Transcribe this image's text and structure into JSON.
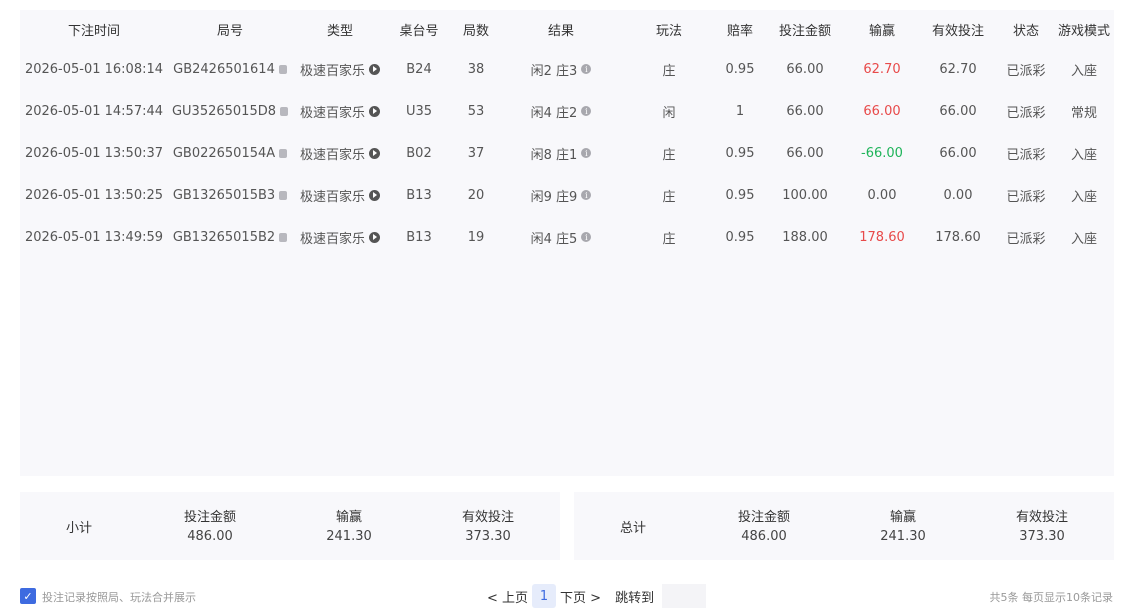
{
  "table": {
    "headers": [
      "下注时间",
      "局号",
      "类型",
      "桌台号",
      "局数",
      "结果",
      "玩法",
      "赔率",
      "投注金额",
      "输赢",
      "有效投注",
      "状态",
      "游戏模式"
    ],
    "rows": [
      {
        "time": "2026-05-01 16:08:14",
        "round_id": "GB2426501614",
        "type": "极速百家乐",
        "table": "B24",
        "count": "38",
        "result": "闲2 庄3",
        "play": "庄",
        "odds": "0.95",
        "bet": "66.00",
        "winloss": "62.70",
        "winloss_color": "red",
        "valid": "62.70",
        "status": "已派彩",
        "mode": "入座"
      },
      {
        "time": "2026-05-01 14:57:44",
        "round_id": "GU35265015D8",
        "type": "极速百家乐",
        "table": "U35",
        "count": "53",
        "result": "闲4 庄2",
        "play": "闲",
        "odds": "1",
        "bet": "66.00",
        "winloss": "66.00",
        "winloss_color": "red",
        "valid": "66.00",
        "status": "已派彩",
        "mode": "常规"
      },
      {
        "time": "2026-05-01 13:50:37",
        "round_id": "GB022650154A",
        "type": "极速百家乐",
        "table": "B02",
        "count": "37",
        "result": "闲8 庄1",
        "play": "庄",
        "odds": "0.95",
        "bet": "66.00",
        "winloss": "-66.00",
        "winloss_color": "green",
        "valid": "66.00",
        "status": "已派彩",
        "mode": "入座"
      },
      {
        "time": "2026-05-01 13:50:25",
        "round_id": "GB13265015B3",
        "type": "极速百家乐",
        "table": "B13",
        "count": "20",
        "result": "闲9 庄9",
        "play": "庄",
        "odds": "0.95",
        "bet": "100.00",
        "winloss": "0.00",
        "winloss_color": "neutral",
        "valid": "0.00",
        "status": "已派彩",
        "mode": "入座"
      },
      {
        "time": "2026-05-01 13:49:59",
        "round_id": "GB13265015B2",
        "type": "极速百家乐",
        "table": "B13",
        "count": "19",
        "result": "闲4 庄5",
        "play": "庄",
        "odds": "0.95",
        "bet": "188.00",
        "winloss": "178.60",
        "winloss_color": "red",
        "valid": "178.60",
        "status": "已派彩",
        "mode": "入座"
      }
    ]
  },
  "subtotal": {
    "label": "小计",
    "bet_title": "投注金额",
    "bet_value": "486.00",
    "winloss_title": "输赢",
    "winloss_value": "241.30",
    "valid_title": "有效投注",
    "valid_value": "373.30"
  },
  "total": {
    "label": "总计",
    "bet_title": "投注金额",
    "bet_value": "486.00",
    "winloss_title": "输赢",
    "winloss_value": "241.30",
    "valid_title": "有效投注",
    "valid_value": "373.30"
  },
  "footer": {
    "merge_label": "投注记录按照局、玩法合并展示",
    "merge_checked": true,
    "prev_label": "< 上页",
    "current_page": "1",
    "next_label": "下页 >",
    "jump_label": "跳转到",
    "jump_value": "",
    "stats": "共5条  每页显示10条记录"
  },
  "colors": {
    "accent": "#3e6be0",
    "win": "#e84a4a",
    "loss": "#1fb45a"
  }
}
